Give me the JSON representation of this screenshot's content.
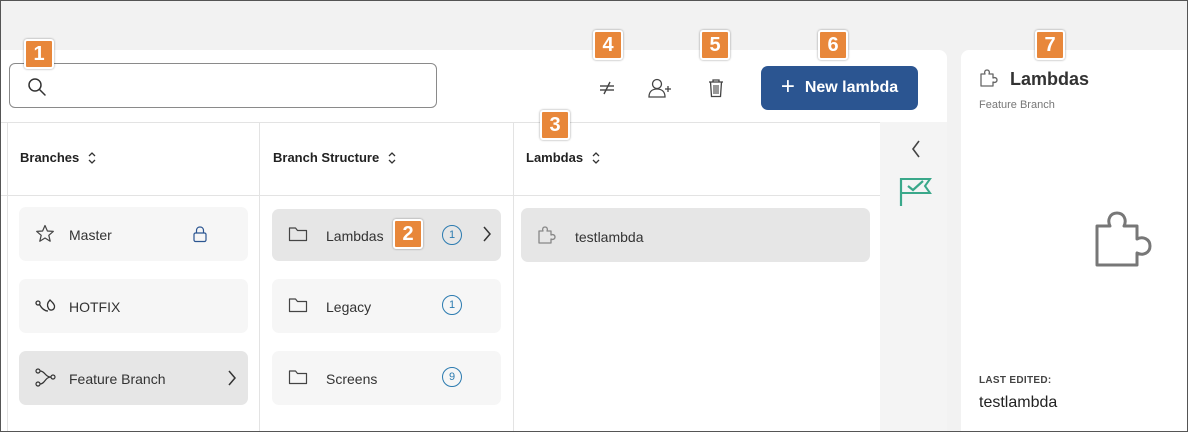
{
  "search": {
    "placeholder": "",
    "value": ""
  },
  "toolbar": {
    "compare_icon": "not-equal-icon",
    "assign_icon": "add-user-icon",
    "delete_icon": "trash-icon",
    "new_button_label": "New lambda"
  },
  "columns": {
    "branches": {
      "header": "Branches",
      "items": [
        {
          "label": "Master",
          "icon": "star-icon",
          "trailing": "lock-icon"
        },
        {
          "label": "HOTFIX",
          "icon": "hotfix-icon"
        },
        {
          "label": "Feature Branch",
          "icon": "branch-icon",
          "trailing": "chevron-right-icon",
          "selected": true
        }
      ]
    },
    "structure": {
      "header": "Branch Structure",
      "items": [
        {
          "label": "Lambdas",
          "count": "1",
          "selected": true
        },
        {
          "label": "Legacy",
          "count": "1"
        },
        {
          "label": "Screens",
          "count": "9"
        }
      ]
    },
    "lambdas": {
      "header": "Lambdas",
      "items": [
        {
          "label": "testlambda",
          "icon": "puzzle-icon",
          "selected": true
        }
      ]
    }
  },
  "details": {
    "title": "Lambdas",
    "subtitle": "Feature Branch",
    "last_edited_label": "LAST EDITED:",
    "last_edited_value": "testlambda"
  },
  "callouts": [
    "1",
    "2",
    "3",
    "4",
    "5",
    "6",
    "7"
  ],
  "colors": {
    "primary_button": "#2b5591",
    "callout": "#e8873a",
    "badge": "#2c7bb0",
    "flag": "#3aa88a"
  }
}
